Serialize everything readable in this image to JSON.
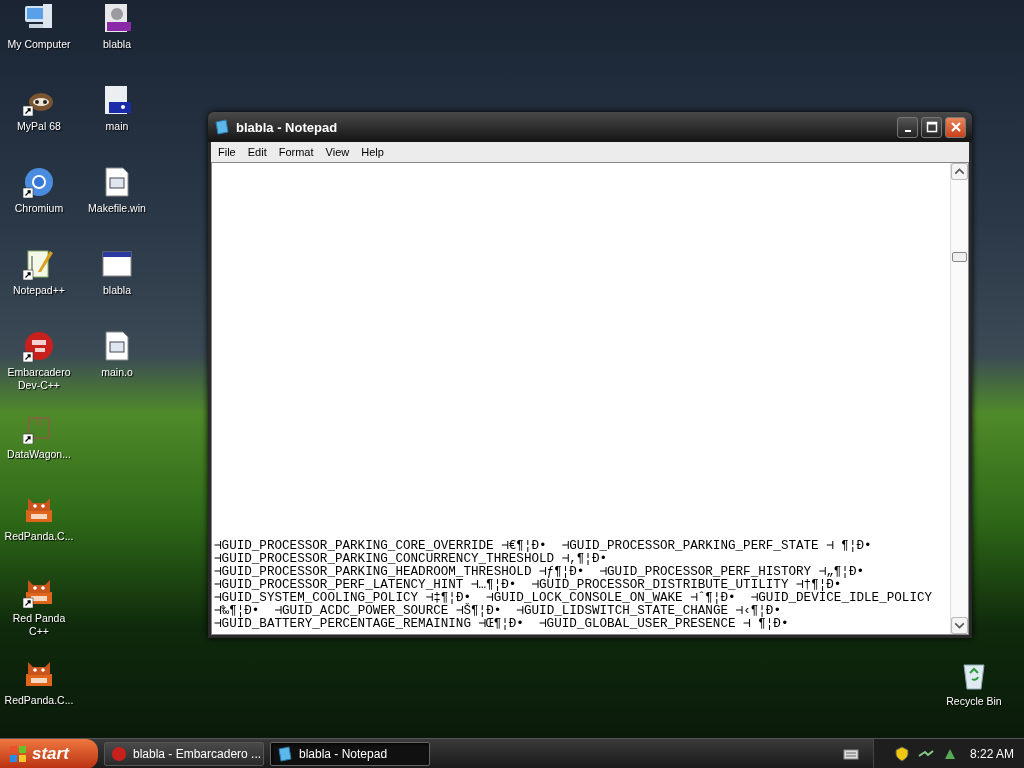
{
  "desktop": {
    "icons_left": [
      {
        "label": "My Computer",
        "kind": "computer",
        "shortcut": false
      },
      {
        "label": "MyPal 68",
        "kind": "raccoon",
        "shortcut": true
      },
      {
        "label": "Chromium",
        "kind": "chromium",
        "shortcut": true
      },
      {
        "label": "Notepad++",
        "kind": "notepadpp",
        "shortcut": true
      },
      {
        "label": "Embarcadero Dev-C++",
        "kind": "devcpp",
        "shortcut": true
      },
      {
        "label": "DataWagon...",
        "kind": "datawagon",
        "shortcut": true
      },
      {
        "label": "RedPanda.C...",
        "kind": "redpanda",
        "shortcut": false
      },
      {
        "label": "Red Panda C++",
        "kind": "redpanda",
        "shortcut": true
      },
      {
        "label": "RedPanda.C...",
        "kind": "redpanda",
        "shortcut": false
      }
    ],
    "icons_right": [
      {
        "label": "blabla",
        "kind": "devfile",
        "shortcut": false
      },
      {
        "label": "main",
        "kind": "cfile",
        "shortcut": false
      },
      {
        "label": "Makefile.win",
        "kind": "document",
        "shortcut": false
      },
      {
        "label": "blabla",
        "kind": "window",
        "shortcut": false
      },
      {
        "label": "main.o",
        "kind": "document",
        "shortcut": false
      }
    ],
    "recycle_bin": {
      "label": "Recycle Bin",
      "kind": "recycle",
      "shortcut": false
    }
  },
  "window": {
    "title": "blabla - Notepad",
    "menu": [
      "File",
      "Edit",
      "Format",
      "View",
      "Help"
    ],
    "lines": [
      "⊣GUID_PROCESSOR_PARKING_CORE_OVERRIDE ⊣€¶¦Ð•  ⊣GUID_PROCESSOR_PARKING_PERF_STATE ⊣ ¶¦Ð•",
      "⊣GUID_PROCESSOR_PARKING_CONCURRENCY_THRESHOLD ⊣,¶¦Ð•",
      "⊣GUID_PROCESSOR_PARKING_HEADROOM_THRESHOLD ⊣ƒ¶¦Ð•  ⊣GUID_PROCESSOR_PERF_HISTORY ⊣„¶¦Ð•",
      "⊣GUID_PROCESSOR_PERF_LATENCY_HINT ⊣…¶¦Ð•  ⊣GUID_PROCESSOR_DISTRIBUTE_UTILITY ⊣†¶¦Ð•",
      "⊣GUID_SYSTEM_COOLING_POLICY ⊣‡¶¦Ð•  ⊣GUID_LOCK_CONSOLE_ON_WAKE ⊣ˆ¶¦Ð•  ⊣GUID_DEVICE_IDLE_POLICY",
      "⊣‰¶¦Ð•  ⊣GUID_ACDC_POWER_SOURCE ⊣Š¶¦Ð•  ⊣GUID_LIDSWITCH_STATE_CHANGE ⊣‹¶¦Ð•",
      "⊣GUID_BATTERY_PERCENTAGE_REMAINING ⊣Œ¶¦Ð•  ⊣GUID_GLOBAL_USER_PRESENCE ⊣ ¶¦Ð•"
    ]
  },
  "taskbar": {
    "start": "start",
    "tasks": [
      {
        "label": "blabla - Embarcadero ...",
        "kind": "devcpp",
        "selected": false
      },
      {
        "label": "blabla - Notepad",
        "kind": "notepad",
        "selected": true
      }
    ],
    "clock": "8:22 AM"
  }
}
